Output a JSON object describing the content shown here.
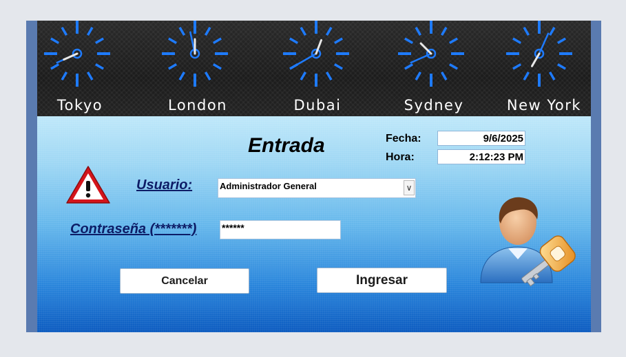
{
  "clocks": [
    {
      "city": "Tokyo",
      "hour": 8.2,
      "minute": 41
    },
    {
      "city": "London",
      "hour": 0.0,
      "minute": 58
    },
    {
      "city": "Dubai",
      "hour": 0.7,
      "minute": 40
    },
    {
      "city": "Sydney",
      "hour": 10.5,
      "minute": 41
    },
    {
      "city": "New York",
      "hour": 7.0,
      "minute": 4
    }
  ],
  "form": {
    "title": "Entrada",
    "fecha_label": "Fecha:",
    "fecha_value": "9/6/2025",
    "hora_label": "Hora:",
    "hora_value": "2:12:23 PM",
    "usuario_label": "Usuario:",
    "usuario_value": "Administrador General",
    "contrasena_label": "Contraseña (*******)",
    "contrasena_value": "******",
    "cancel_label": "Cancelar",
    "submit_label": "Ingresar"
  },
  "icons": {
    "warning": "warning-icon",
    "user_key": "user-key-icon",
    "dropdown": "chevron-down-icon"
  },
  "colors": {
    "clock_blue": "#1e7bff",
    "title_color": "#000000",
    "label_color": "#0d1c66",
    "warning_red": "#d4141b"
  }
}
